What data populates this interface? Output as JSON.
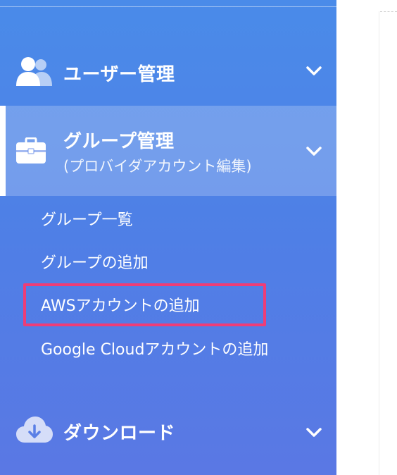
{
  "sidebar": {
    "menus": [
      {
        "label": "ユーザー管理",
        "icon": "users-icon"
      },
      {
        "label": "グループ管理",
        "sublabel": "(プロバイダアカウント編集)",
        "icon": "briefcase-icon"
      },
      {
        "label": "ダウンロード",
        "icon": "cloud-download-icon"
      }
    ],
    "group_items": [
      {
        "label": "グループ一覧"
      },
      {
        "label": "グループの追加"
      },
      {
        "label": "AWSアカウントの追加"
      },
      {
        "label": "Google Cloudアカウントの追加"
      }
    ]
  },
  "colors": {
    "sidebar_top": "#4a8be9",
    "sidebar_bottom": "#5a78e4",
    "highlight_border": "#ee3d77",
    "text": "#ffffff"
  }
}
